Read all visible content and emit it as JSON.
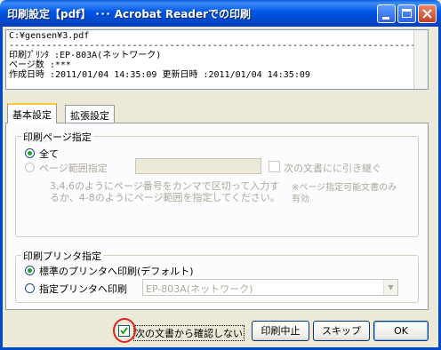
{
  "window": {
    "title": "印刷設定【pdf】 ･･･ Acrobat Readerでの印刷"
  },
  "info": {
    "lines": [
      "C:¥gensen¥3.pdf",
      "--------------------------------------------------------------------------------",
      "印刷ﾌﾟﾘﾝﾀ :EP-803A(ネットワーク)",
      "ページ数   :***",
      "作成日時 :2011/01/04 14:35:09  更新日時 :2011/01/04 14:35:09"
    ]
  },
  "tabs": [
    {
      "label": "基本設定"
    },
    {
      "label": "拡張設定"
    }
  ],
  "page_group": {
    "title": "印刷ページ指定",
    "all_label": "全て",
    "range_label": "ページ範囲指定",
    "range_value": "",
    "next_doc_label": "次の文書にに引き継ぐ",
    "hint": "3,4,6のようにページ番号をカンマで区切って入力するか、4-8のようにページ範囲を指定してください。",
    "note": "※ページ指定可能文書のみ有効"
  },
  "printer_group": {
    "title": "印刷プリンタ指定",
    "default_label": "標準のプリンタへ印刷(デフォルト)",
    "specified_label": "指定プリンタへ印刷",
    "printer_value": "EP-803A(ネットワーク)"
  },
  "footer": {
    "no_confirm_label": "次の文書から確認しない",
    "no_confirm_checked": true,
    "cancel_label": "印刷中止",
    "skip_label": "スキップ",
    "ok_label": "OK"
  },
  "colors": {
    "titlebar": "#0055E5",
    "annotation_circle": "#E0201B",
    "radio_dot": "#21A121"
  }
}
